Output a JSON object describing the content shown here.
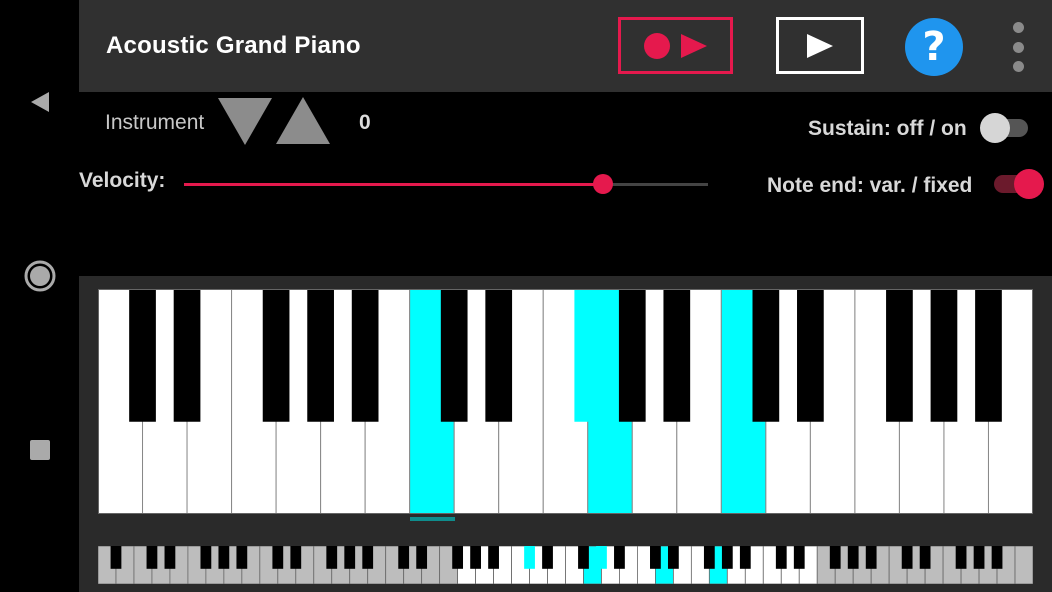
{
  "app": {
    "title": "Acoustic Grand Piano"
  },
  "instrument": {
    "label": "Instrument",
    "value": "0"
  },
  "sustain": {
    "label": "Sustain: off / on",
    "state": "off"
  },
  "note_end": {
    "label": "Note end: var. / fixed",
    "state": "on"
  },
  "velocity": {
    "label": "Velocity:",
    "value_fraction": 0.8
  },
  "colors": {
    "accent": "#e5194d",
    "help_blue": "#1f95ee",
    "pressed_key": "#00ffff",
    "range_indicator": "#0f8d8d"
  },
  "icons": {
    "back": "triangle-left-icon",
    "home": "circle-icon",
    "recents": "square-icon",
    "record": "record-dot-icon",
    "play": "play-triangle-icon",
    "help": "question-mark-icon",
    "overflow": "vertical-dots-icon",
    "instrument_down": "triangle-down-icon",
    "instrument_up": "triangle-up-icon"
  },
  "help_symbol": "?",
  "main_keyboard": {
    "white_key_count": 21,
    "pressed_white_keys": [
      7,
      11,
      14
    ],
    "pressed_black_keys": [
      6,
      10
    ]
  },
  "mini_keyboard": {
    "white_key_count": 52,
    "visible_range_white_keys": [
      20,
      40
    ],
    "pressed_white_keys": [
      27,
      31,
      34
    ],
    "pressed_black_keys": [
      23,
      27
    ]
  }
}
